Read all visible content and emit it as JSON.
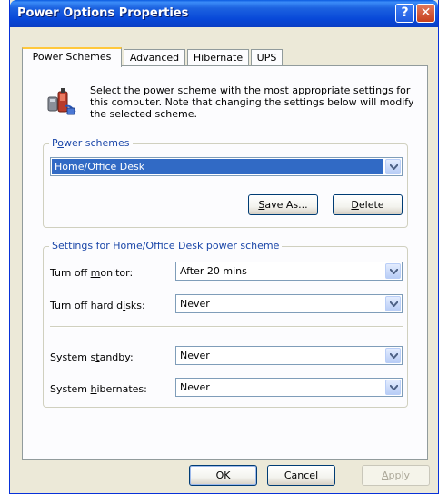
{
  "window": {
    "title": "Power Options Properties",
    "help_glyph": "?",
    "close_glyph": "✕"
  },
  "tabs": [
    "Power Schemes",
    "Advanced",
    "Hibernate",
    "UPS"
  ],
  "intro_text": "Select the power scheme with the most appropriate settings for this computer. Note that changing the settings below will modify the selected scheme.",
  "schemes_group": {
    "label_prefix": "P",
    "label_access": "o",
    "label_rest": "wer schemes",
    "selected": "Home/Office Desk",
    "save_as_access": "S",
    "save_as_rest": "ave As...",
    "delete_access": "D",
    "delete_rest": "elete"
  },
  "settings_group": {
    "label": "Settings for Home/Office Desk power scheme",
    "rows": [
      {
        "label_pre": "Turn off ",
        "label_access": "m",
        "label_post": "onitor:",
        "value": "After 20 mins"
      },
      {
        "label_pre": "Turn off hard d",
        "label_access": "i",
        "label_post": "sks:",
        "value": "Never"
      },
      {
        "label_pre": "System s",
        "label_access": "t",
        "label_post": "andby:",
        "value": "Never"
      },
      {
        "label_pre": "System ",
        "label_access": "h",
        "label_post": "ibernates:",
        "value": "Never"
      }
    ]
  },
  "footer": {
    "ok": "OK",
    "cancel": "Cancel",
    "apply_access": "A",
    "apply_rest": "pply"
  }
}
